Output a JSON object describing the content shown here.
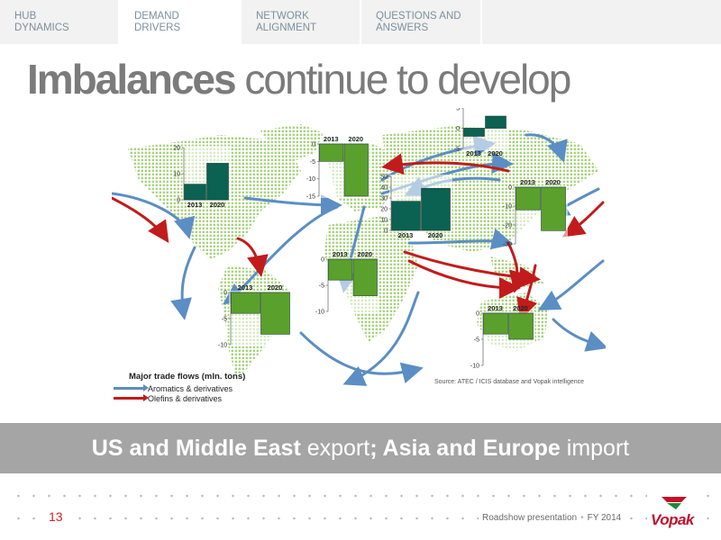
{
  "tabs": [
    {
      "line1": "HUB",
      "line2": "DYNAMICS",
      "active": false
    },
    {
      "line1": "DEMAND",
      "line2": "DRIVERS",
      "active": true
    },
    {
      "line1": "NETWORK",
      "line2": "ALIGNMENT",
      "active": false
    },
    {
      "line1": "QUESTIONS AND",
      "line2": "ANSWERS",
      "active": false
    }
  ],
  "title": {
    "bold": "Imbalances",
    "rest": " continue to develop"
  },
  "colors": {
    "aromatics": "#5b8ec4",
    "olefins": "#c21b1b",
    "bar_dark": "#0b6152",
    "bar_light": "#5aa02c",
    "map_dot": "#a9d37f"
  },
  "legend": {
    "heading": "Major trade flows (mln. tons)",
    "items": [
      {
        "label": "Aromatics & derivatives",
        "color": "#5b8ec4"
      },
      {
        "label": "Olefins & derivatives",
        "color": "#c21b1b"
      }
    ]
  },
  "source": "Source: ATEC / ICIS database and Vopak intelligence",
  "banner": {
    "part1": "US and Middle East",
    "part2": " export",
    "part3": "; ",
    "part4": "Asia and Europe",
    "part5": " import"
  },
  "footer": {
    "page": "13",
    "presentation": "Roadshow presentation",
    "period": "FY 2014",
    "logo": "Vopak"
  },
  "chart_data": [
    {
      "region": "North America",
      "type": "bar",
      "categories": [
        "2013",
        "2020"
      ],
      "values": [
        6,
        14
      ],
      "ylim": [
        0,
        20
      ],
      "ticks": [
        "20",
        "10",
        "0"
      ],
      "color": "#0b6152"
    },
    {
      "region": "Europe",
      "type": "bar",
      "categories": [
        "2013",
        "2020"
      ],
      "values": [
        -5,
        -15
      ],
      "ylim": [
        -15,
        0
      ],
      "ticks": [
        "0",
        "-5",
        "-10",
        "-15"
      ],
      "color": "#5aa02c"
    },
    {
      "region": "Russia / Central Asia",
      "type": "bar",
      "categories": [
        "2013",
        "2020"
      ],
      "values": [
        -2,
        3
      ],
      "ylim": [
        -5,
        5
      ],
      "ticks": [
        "5",
        "0",
        "-5"
      ],
      "color": "#0b6152"
    },
    {
      "region": "Middle East",
      "type": "bar",
      "categories": [
        "2013",
        "2020"
      ],
      "values": [
        27,
        39
      ],
      "ylim": [
        0,
        50
      ],
      "ticks": [
        "50",
        "40",
        "30",
        "20",
        "10",
        "0"
      ],
      "color": "#0b6152"
    },
    {
      "region": "China / North Asia",
      "type": "bar",
      "categories": [
        "2013",
        "2020"
      ],
      "values": [
        -12,
        -23
      ],
      "ylim": [
        -30,
        0
      ],
      "ticks": [
        "0",
        "-10",
        "-20",
        "-30"
      ],
      "color": "#5aa02c"
    },
    {
      "region": "Africa",
      "type": "bar",
      "categories": [
        "2013",
        "2020"
      ],
      "values": [
        -4,
        -7
      ],
      "ylim": [
        -10,
        0
      ],
      "ticks": [
        "0",
        "-5",
        "-10"
      ],
      "color": "#5aa02c"
    },
    {
      "region": "South America",
      "type": "bar",
      "categories": [
        "2013",
        "2020"
      ],
      "values": [
        -4,
        -8
      ],
      "ylim": [
        -10,
        0
      ],
      "ticks": [
        "0",
        "-5",
        "-10"
      ],
      "color": "#5aa02c"
    },
    {
      "region": "South East Asia",
      "type": "bar",
      "categories": [
        "2013",
        "2020"
      ],
      "values": [
        -4,
        -5
      ],
      "ylim": [
        -10,
        0
      ],
      "ticks": [
        "0",
        "-5",
        "-10"
      ],
      "color": "#5aa02c"
    }
  ]
}
